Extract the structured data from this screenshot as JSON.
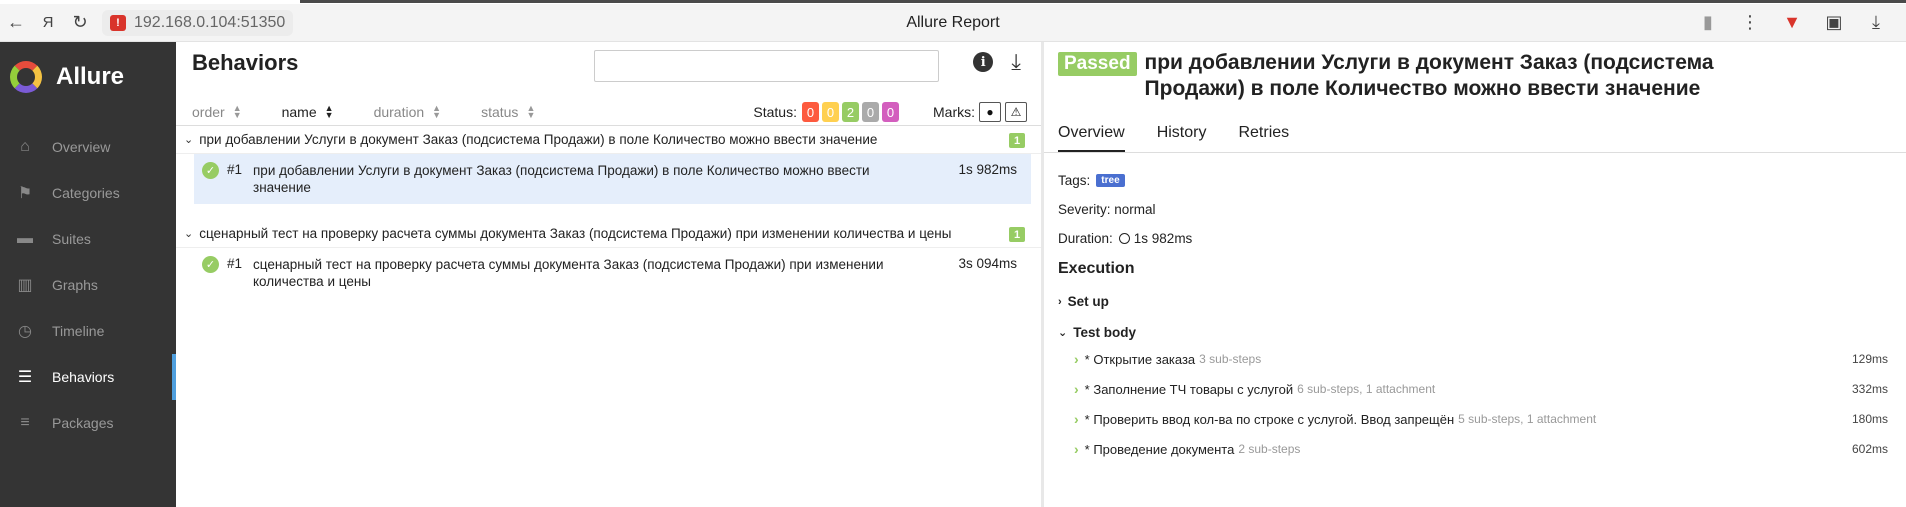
{
  "browser": {
    "url": "192.168.0.104:51350",
    "page_title": "Allure Report"
  },
  "sidebar": {
    "brand": "Allure",
    "items": [
      {
        "label": "Overview",
        "icon": "home-icon"
      },
      {
        "label": "Categories",
        "icon": "flag-icon"
      },
      {
        "label": "Suites",
        "icon": "briefcase-icon"
      },
      {
        "label": "Graphs",
        "icon": "bar-chart-icon"
      },
      {
        "label": "Timeline",
        "icon": "clock-icon"
      },
      {
        "label": "Behaviors",
        "icon": "list-icon",
        "active": true
      },
      {
        "label": "Packages",
        "icon": "packages-icon"
      }
    ]
  },
  "behaviors": {
    "title": "Behaviors",
    "search_placeholder": "",
    "sort": [
      "order",
      "name",
      "duration",
      "status"
    ],
    "status_label": "Status:",
    "status_counts": [
      {
        "value": "0",
        "color": "#fd5a3e"
      },
      {
        "value": "0",
        "color": "#ffd050"
      },
      {
        "value": "2",
        "color": "#97cc64"
      },
      {
        "value": "0",
        "color": "#aaaaaa"
      },
      {
        "value": "0",
        "color": "#d35ebe"
      }
    ],
    "marks_label": "Marks:",
    "groups": [
      {
        "name": "при добавлении Услуги в документ Заказ (подсистема Продажи) в поле Количество можно ввести значение",
        "count": "1",
        "case_num": "#1",
        "case_name": "при добавлении Услуги в документ Заказ (подсистема Продажи) в поле Количество можно ввести значение",
        "case_duration": "1s 982ms"
      },
      {
        "name": "сценарный тест на проверку расчета суммы документа Заказ (подсистема Продажи) при изменении количества и цены",
        "count": "1",
        "case_num": "#1",
        "case_name": "сценарный тест на проверку расчета суммы документа Заказ (подсистема Продажи) при изменении количества и цены",
        "case_duration": "3s 094ms"
      }
    ]
  },
  "details": {
    "status": "Passed",
    "title": "при добавлении Услуги в документ Заказ (подсистема Продажи) в поле Количество можно ввести значение",
    "tabs": [
      "Overview",
      "History",
      "Retries"
    ],
    "tags_label": "Tags:",
    "tag": "tree",
    "severity": "Severity: normal",
    "duration_label": "Duration:",
    "duration": "1s 982ms",
    "execution": "Execution",
    "setup": "Set up",
    "test_body": "Test body",
    "steps": [
      {
        "name": "* Открытие заказа",
        "meta": "3 sub-steps",
        "duration": "129ms"
      },
      {
        "name": "* Заполнение ТЧ товары с услугой",
        "meta": "6 sub-steps, 1 attachment",
        "duration": "332ms"
      },
      {
        "name": "* Проверить ввод кол-ва по строке с услугой. Ввод запрещён",
        "meta": "5 sub-steps, 1 attachment",
        "duration": "180ms"
      },
      {
        "name": "* Проведение документа",
        "meta": "2 sub-steps",
        "duration": "602ms"
      }
    ]
  }
}
